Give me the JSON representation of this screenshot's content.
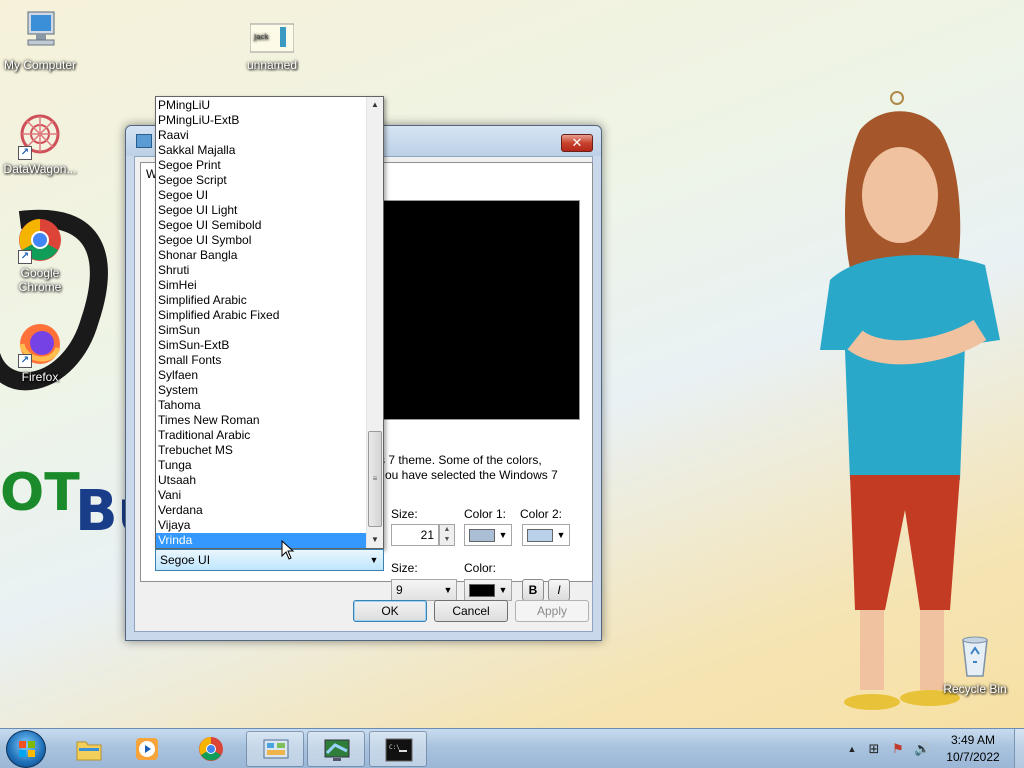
{
  "desktop": {
    "icons": [
      {
        "label": "My Computer",
        "icon": "computer-icon"
      },
      {
        "label": "unnamed",
        "icon": "image-file-icon"
      },
      {
        "label": "DataWagon...",
        "icon": "datawagon-icon"
      },
      {
        "label": "Google Chrome",
        "icon": "chrome-icon"
      },
      {
        "label": "Firefox",
        "icon": "firefox-icon"
      },
      {
        "label": "Recycle Bin",
        "icon": "recycle-bin-icon"
      }
    ]
  },
  "dialog": {
    "close_label": "✕",
    "tab_head": "W",
    "description_line1": "s 7 theme.  Some of the colors,",
    "description_line2": "ou have selected the Windows 7",
    "item_row": {
      "size_label": "Size:",
      "size_value": "21",
      "color1_label": "Color 1:",
      "color2_label": "Color 2:",
      "color1": "#aabed6",
      "color2": "#b9d1ea"
    },
    "font_row": {
      "font_value": "Segoe UI",
      "size_label": "Size:",
      "size_value": "9",
      "color_label": "Color:",
      "color": "#000000",
      "bold_label": "B",
      "italic_label": "I"
    },
    "buttons": {
      "ok": "OK",
      "cancel": "Cancel",
      "apply": "Apply"
    }
  },
  "font_list": {
    "items": [
      "PMingLiU",
      "PMingLiU-ExtB",
      "Raavi",
      "Sakkal Majalla",
      "Segoe Print",
      "Segoe Script",
      "Segoe UI",
      "Segoe UI Light",
      "Segoe UI Semibold",
      "Segoe UI Symbol",
      "Shonar Bangla",
      "Shruti",
      "SimHei",
      "Simplified Arabic",
      "Simplified Arabic Fixed",
      "SimSun",
      "SimSun-ExtB",
      "Small Fonts",
      "Sylfaen",
      "System",
      "Tahoma",
      "Times New Roman",
      "Traditional Arabic",
      "Trebuchet MS",
      "Tunga",
      "Utsaah",
      "Vani",
      "Verdana",
      "Vijaya",
      "Vrinda"
    ],
    "selected": "Vrinda"
  },
  "taskbar": {
    "items": [
      {
        "icon": "explorer-icon",
        "active": false
      },
      {
        "icon": "media-player-icon",
        "active": false
      },
      {
        "icon": "chrome-icon",
        "active": false
      },
      {
        "icon": "control-panel-icon",
        "active": true
      },
      {
        "icon": "display-settings-icon",
        "active": true
      },
      {
        "icon": "command-prompt-icon",
        "active": true
      }
    ],
    "clock": {
      "time": "3:49 AM",
      "date": "10/7/2022"
    }
  }
}
